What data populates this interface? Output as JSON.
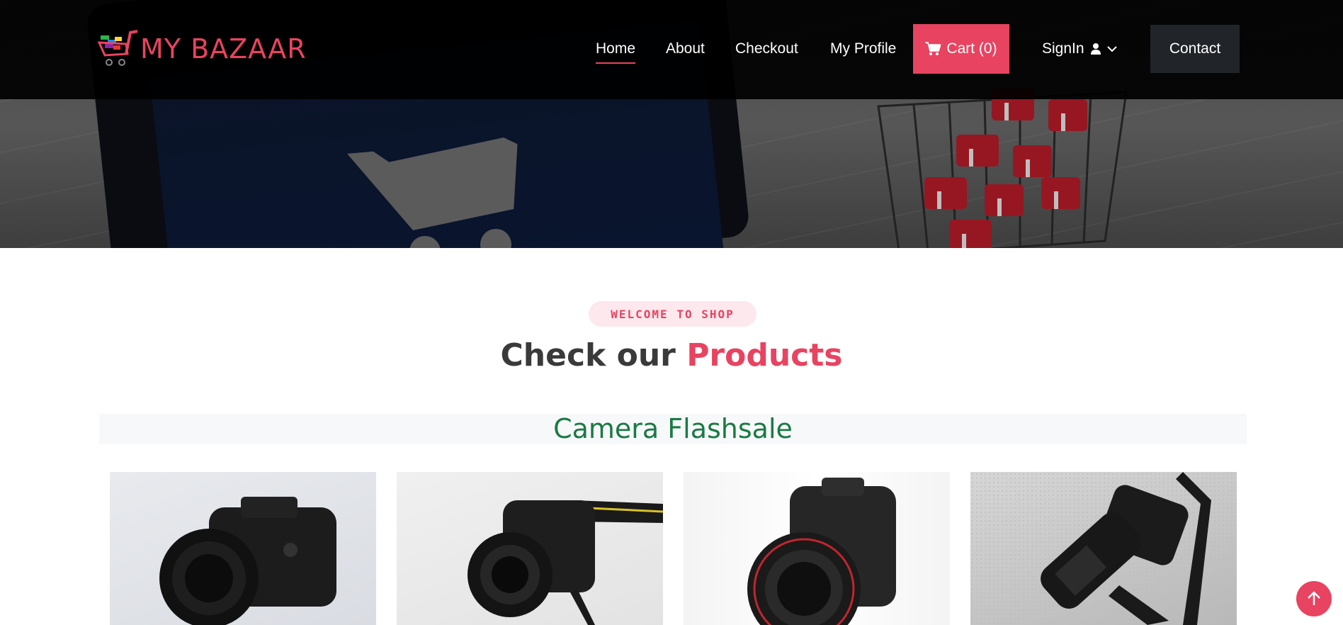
{
  "brand": {
    "name": "MY BAZAAR",
    "accent_color": "#e84360"
  },
  "nav": {
    "home": "Home",
    "about": "About",
    "checkout": "Checkout",
    "profile": "My Profile",
    "cart": "Cart (0)",
    "signin": "SignIn",
    "contact": "Contact"
  },
  "section": {
    "welcome": "WELCOME TO SHOP",
    "title_part1": "Check our",
    "title_part2": "Products"
  },
  "flashsale": {
    "title": "Camera Flashsale",
    "color": "#1a7a43"
  },
  "products": [
    {
      "image": "dslr-camera-front-photo"
    },
    {
      "image": "dslr-camera-with-strap-photo"
    },
    {
      "image": "canon-camera-wide-lens-photo"
    },
    {
      "image": "camera-on-pavement-bw-photo"
    }
  ],
  "icons": {
    "cart": "cart-icon",
    "user": "user-icon",
    "chevron": "chevron-down-icon",
    "scroll_top": "arrow-up-icon"
  }
}
